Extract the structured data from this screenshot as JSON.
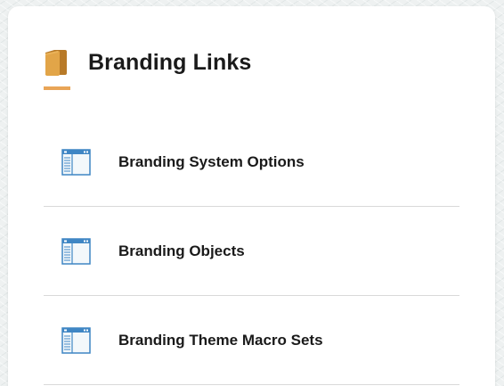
{
  "card": {
    "title": "Branding Links",
    "title_icon": "folder-icon",
    "accent_color": "#e9a557",
    "links": [
      {
        "label": "Branding System Options",
        "icon": "window-panel-icon"
      },
      {
        "label": "Branding Objects",
        "icon": "window-panel-icon"
      },
      {
        "label": "Branding Theme Macro Sets",
        "icon": "window-panel-icon"
      }
    ]
  }
}
